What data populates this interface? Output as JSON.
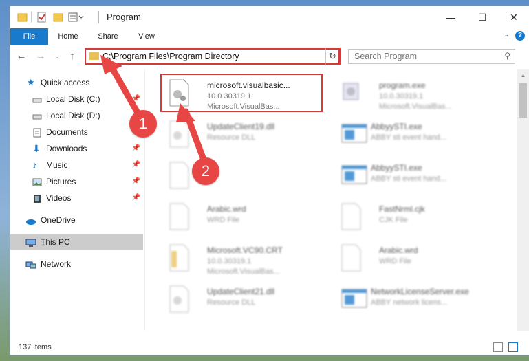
{
  "window": {
    "title": "Program"
  },
  "ribbon": {
    "tabs": [
      "File",
      "Home",
      "Share",
      "View"
    ],
    "help": "?"
  },
  "address": {
    "path": "C:\\Program Files\\Program Directory"
  },
  "search": {
    "placeholder": "Search Program"
  },
  "nav": {
    "quick_access": "Quick access",
    "items": [
      {
        "label": "Local Disk (C:)",
        "icon": "drive-icon",
        "pinned": true
      },
      {
        "label": "Local Disk (D:)",
        "icon": "drive-icon",
        "pinned": false
      },
      {
        "label": "Documents",
        "icon": "documents-icon",
        "pinned": true
      },
      {
        "label": "Downloads",
        "icon": "downloads-icon",
        "pinned": true
      },
      {
        "label": "Music",
        "icon": "music-icon",
        "pinned": true
      },
      {
        "label": "Pictures",
        "icon": "pictures-icon",
        "pinned": true
      },
      {
        "label": "Videos",
        "icon": "videos-icon",
        "pinned": true
      }
    ],
    "onedrive": "OneDrive",
    "this_pc": "This PC",
    "network": "Network"
  },
  "files": [
    {
      "name": "microsoft.visualbasic...",
      "line1": "10.0.30319.1",
      "line2": "Microsoft.VisualBas...",
      "icon": "settings-file-icon",
      "highlighted": true
    },
    {
      "name": "program.exe",
      "line1": "10.0.30319.1",
      "line2": "Microsoft.VisualBas...",
      "icon": "exe-icon"
    },
    {
      "name": "UpdateClient19.dll",
      "line1": "Resource DLL",
      "line2": "",
      "icon": "dll-icon"
    },
    {
      "name": "AbbyySTI.exe",
      "line1": "ABBY sti event hand...",
      "line2": "",
      "icon": "exe-window-icon"
    },
    {
      "name": "",
      "line1": "",
      "line2": "",
      "icon": "blank-file-icon"
    },
    {
      "name": "AbbyySTI.exe",
      "line1": "ABBY sti event hand...",
      "line2": "",
      "icon": "exe-window-icon"
    },
    {
      "name": "Arabic.wrd",
      "line1": "WRD File",
      "line2": "",
      "icon": "blank-file-icon"
    },
    {
      "name": "FastNrml.cjk",
      "line1": "CJK File",
      "line2": "",
      "icon": "blank-file-icon"
    },
    {
      "name": "Microsoft.VC90.CRT",
      "line1": "10.0.30319.1",
      "line2": "Microsoft.VisualBas...",
      "icon": "manifest-file-icon"
    },
    {
      "name": "Arabic.wrd",
      "line1": "WRD File",
      "line2": "",
      "icon": "blank-file-icon"
    },
    {
      "name": "UpdateClient21.dll",
      "line1": "Resource DLL",
      "line2": "",
      "icon": "dll-icon"
    },
    {
      "name": "NetworkLicenseServer.exe",
      "line1": "ABBY network licens...",
      "line2": "",
      "icon": "exe-window-icon"
    }
  ],
  "status": {
    "count": "137 items"
  },
  "callouts": [
    "1",
    "2"
  ],
  "colors": {
    "accent": "#1979ca",
    "callout": "#e84545",
    "highlight": "#d33b3b"
  }
}
